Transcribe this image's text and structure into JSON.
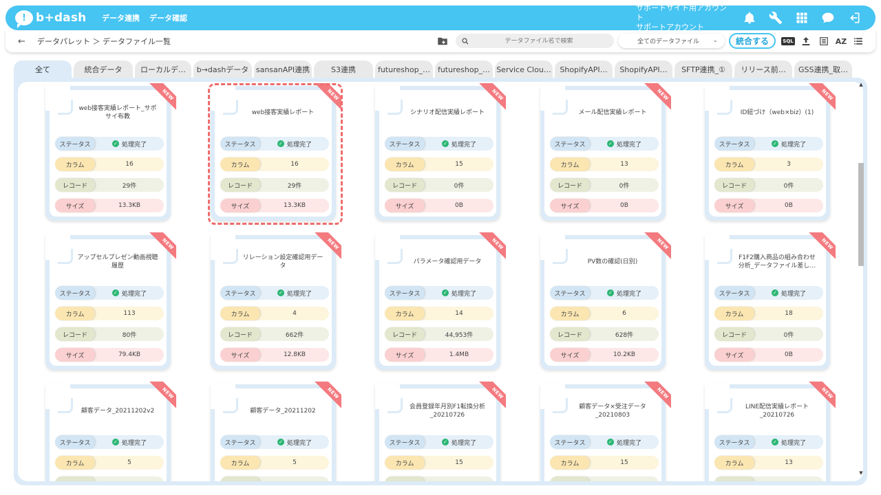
{
  "app": {
    "logo_text": "b+dash",
    "nav": [
      "データ連携",
      "データ確認"
    ],
    "account_line1": "サポートサイト用アカウント",
    "account_line2": "サポートアカウント"
  },
  "subbar": {
    "back": "←",
    "breadcrumb": "データパレット ＞ データファイル一覧",
    "search_placeholder": "データファイル名で検索",
    "filter_value": "全てのデータファイル",
    "merge_button": "統合する",
    "sql_label": "SQL",
    "sort_label": "AZ"
  },
  "tabs": [
    {
      "label": "全て",
      "w": 84
    },
    {
      "label": "統合データ",
      "w": 86
    },
    {
      "label": "ローカルデ…",
      "w": 82
    },
    {
      "label": "b→dashデータ",
      "w": 85
    },
    {
      "label": "sansanAPI連携",
      "w": 84
    },
    {
      "label": "S3連携",
      "w": 86
    },
    {
      "label": "futureshop_…",
      "w": 84
    },
    {
      "label": "futureshop_…",
      "w": 84
    },
    {
      "label": "Service Clou…",
      "w": 84
    },
    {
      "label": "ShopifyAPI…",
      "w": 84
    },
    {
      "label": "ShopifyAPI…",
      "w": 84
    },
    {
      "label": "SFTP連携_①",
      "w": 84
    },
    {
      "label": "リリース前…",
      "w": 84
    },
    {
      "label": "GSS連携_取…",
      "w": 84
    }
  ],
  "labels": {
    "status": "ステータス",
    "column": "カラム",
    "record": "レコード",
    "size": "サイズ",
    "new": "NEW"
  },
  "cards": [
    {
      "title": "web接客実績レポート_サポサイ布教",
      "status": "処理完了",
      "columns": "16",
      "records": "29件",
      "size": "13.3KB"
    },
    {
      "title": "web接客実績レポート",
      "status": "処理完了",
      "columns": "16",
      "records": "29件",
      "size": "13.3KB"
    },
    {
      "title": "シナリオ配信実績レポート",
      "status": "処理完了",
      "columns": "15",
      "records": "0件",
      "size": "0B"
    },
    {
      "title": "メール配信実績レポート",
      "status": "処理完了",
      "columns": "13",
      "records": "0件",
      "size": "0B"
    },
    {
      "title": "ID紐づけ（web×biz）(1)",
      "status": "処理完了",
      "columns": "3",
      "records": "0件",
      "size": "0B"
    },
    {
      "title": "アップセルプレゼン動画視聴履歴",
      "status": "処理完了",
      "columns": "113",
      "records": "80件",
      "size": "79.4KB"
    },
    {
      "title": "リレーション設定確認用データ",
      "status": "処理完了",
      "columns": "4",
      "records": "662件",
      "size": "12.8KB"
    },
    {
      "title": "パラメータ確認用データ",
      "status": "処理完了",
      "columns": "14",
      "records": "44,953件",
      "size": "1.4MB"
    },
    {
      "title": "PV数の確認(日別)",
      "status": "処理完了",
      "columns": "6",
      "records": "628件",
      "size": "10.2KB"
    },
    {
      "title": "F1F2購入商品の組み合わせ分析_データファイル差し…",
      "status": "処理完了",
      "columns": "18",
      "records": "0件",
      "size": "0B"
    },
    {
      "title": "顧客データ_20211202v2",
      "status": "処理完了",
      "columns": "5",
      "records": "",
      "size": ""
    },
    {
      "title": "顧客データ_20211202",
      "status": "処理完了",
      "columns": "5",
      "records": "",
      "size": ""
    },
    {
      "title": "会員登録年月別F1転換分析_20210726",
      "status": "処理完了",
      "columns": "15",
      "records": "",
      "size": ""
    },
    {
      "title": "顧客データ×受注データ_20210803",
      "status": "処理完了",
      "columns": "15",
      "records": "",
      "size": ""
    },
    {
      "title": "LINE配信実績レポート_20210726",
      "status": "処理完了",
      "columns": "13",
      "records": "",
      "size": ""
    }
  ],
  "colors": {
    "brand": "#46c4f2",
    "new_ribbon": "#f37a7f",
    "selection_outline": "#ee6c6c",
    "check": "#2bb673"
  }
}
